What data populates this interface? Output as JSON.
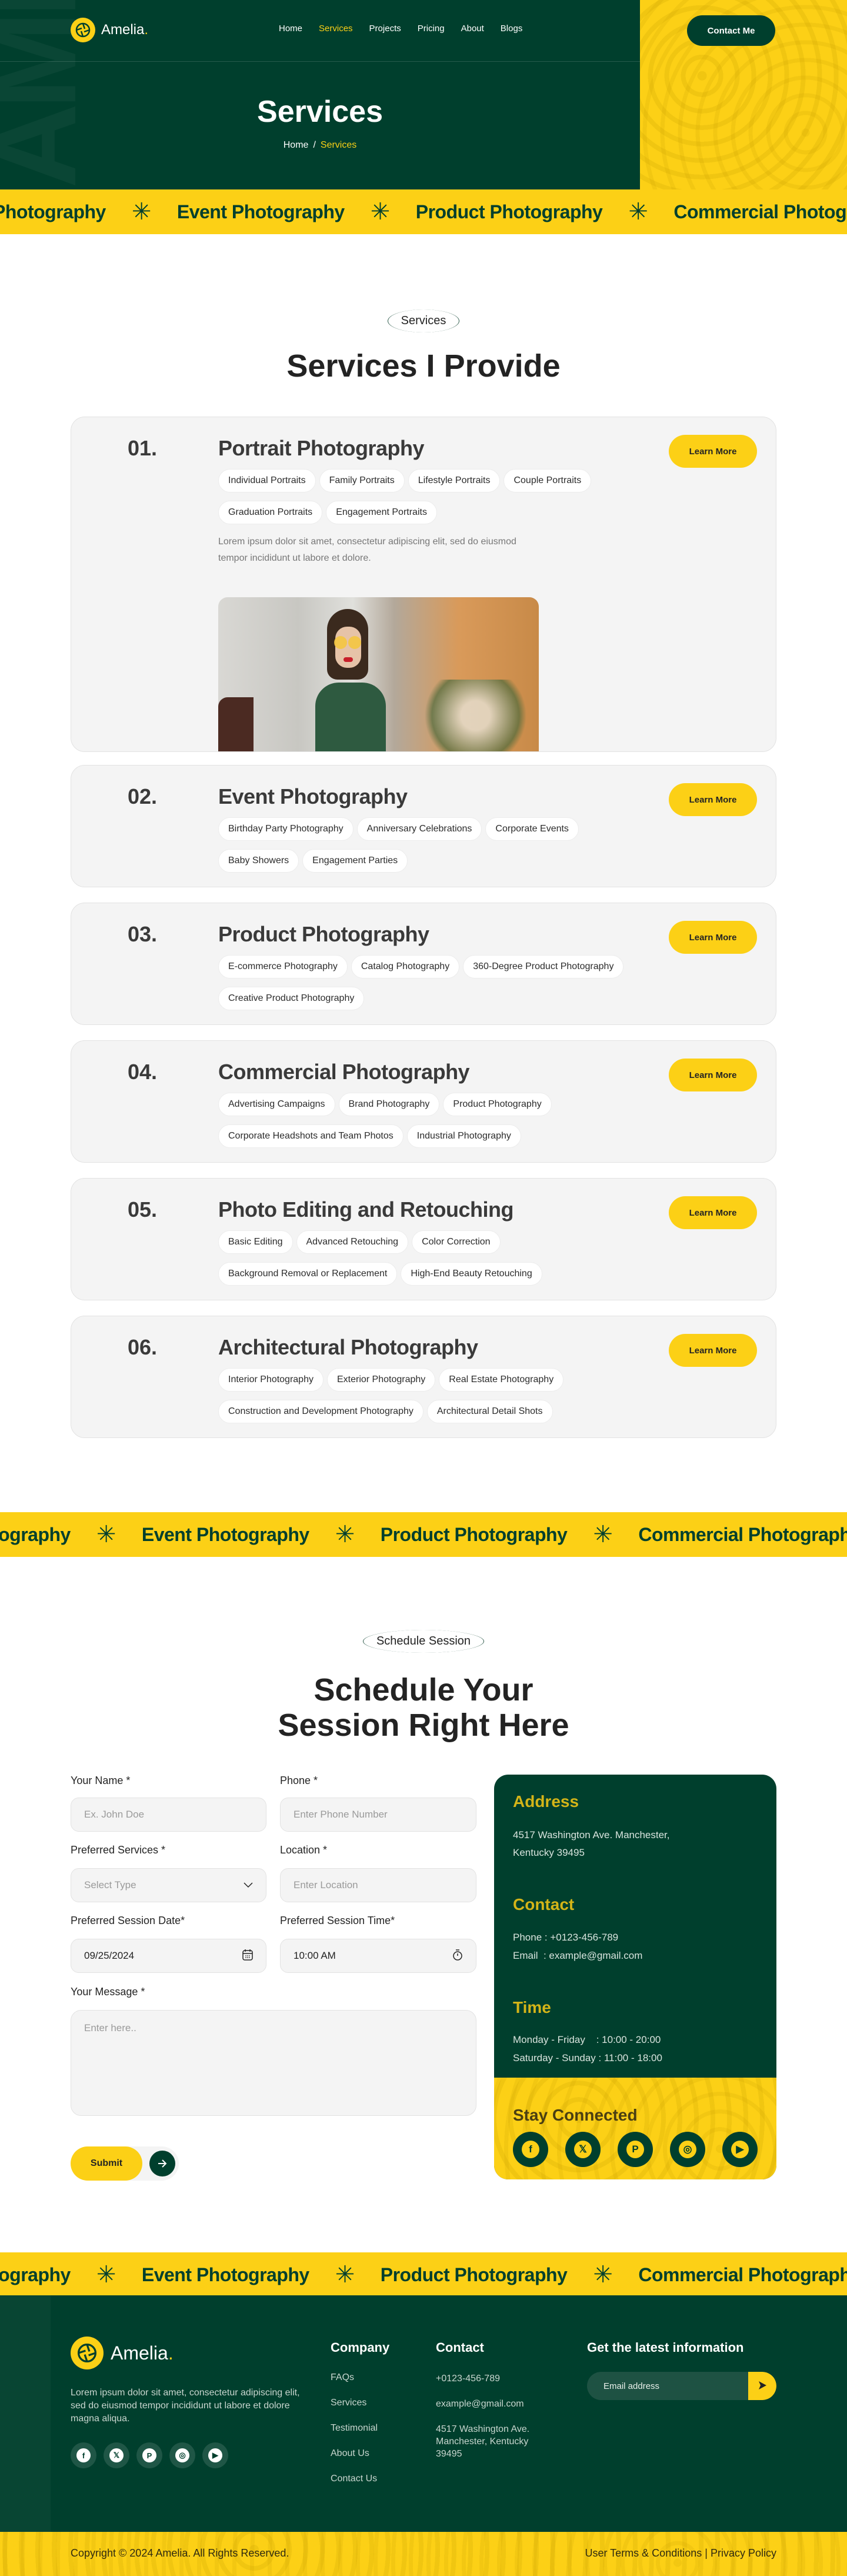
{
  "brand": {
    "name": "Amelia",
    "dot": "."
  },
  "nav": {
    "items": [
      {
        "label": "Home",
        "active": false
      },
      {
        "label": "Services",
        "active": true
      },
      {
        "label": "Projects",
        "active": false
      },
      {
        "label": "Pricing",
        "active": false
      },
      {
        "label": "About",
        "active": false
      },
      {
        "label": "Blogs",
        "active": false
      }
    ],
    "contact_button": "Contact Me"
  },
  "hero": {
    "title": "Services",
    "breadcrumb": {
      "home": "Home",
      "separator": "/",
      "current": "Services"
    }
  },
  "marquee": {
    "items": [
      "Photography",
      "Event Photography",
      "Product Photography",
      "Commercial Photography"
    ],
    "separator_icon": "asterisk-star-icon"
  },
  "services_section": {
    "tag": "Services",
    "title": "Services I Provide",
    "learn_more_label": "Learn More",
    "cards": [
      {
        "num": "01.",
        "title": "Portrait Photography",
        "tags": [
          "Individual Portraits",
          "Family Portraits",
          "Lifestyle Portraits",
          "Couple Portraits",
          "Graduation Portraits",
          "Engagement Portraits"
        ],
        "description": "Lorem ipsum dolor sit amet, consectetur adipiscing elit, sed do eiusmod tempor incididunt ut labore et dolore.",
        "has_image": true
      },
      {
        "num": "02.",
        "title": "Event Photography",
        "tags": [
          "Birthday Party Photography",
          "Anniversary Celebrations",
          "Corporate Events",
          "Baby Showers",
          "Engagement Parties"
        ]
      },
      {
        "num": "03.",
        "title": "Product Photography",
        "tags": [
          "E-commerce Photography",
          "Catalog Photography",
          "360-Degree Product Photography",
          "Creative Product Photography"
        ]
      },
      {
        "num": "04.",
        "title": "Commercial Photography",
        "tags": [
          "Advertising Campaigns",
          "Brand Photography",
          "Product Photography",
          "Corporate Headshots and Team Photos",
          "Industrial Photography"
        ]
      },
      {
        "num": "05.",
        "title": "Photo Editing and Retouching",
        "tags": [
          "Basic Editing",
          "Advanced Retouching",
          "Color Correction",
          "Background Removal or Replacement",
          "High-End Beauty Retouching"
        ]
      },
      {
        "num": "06.",
        "title": "Architectural Photography",
        "tags": [
          "Interior Photography",
          "Exterior Photography",
          "Real Estate Photography",
          "Construction and Development Photography",
          "Architectural Detail Shots"
        ]
      }
    ]
  },
  "schedule": {
    "tag": "Schedule Session",
    "title_line1": "Schedule Your",
    "title_line2": "Session Right Here",
    "form": {
      "name": {
        "label": "Your Name *",
        "placeholder": "Ex. John Doe"
      },
      "phone": {
        "label": "Phone *",
        "placeholder": "Enter Phone Number"
      },
      "services": {
        "label": "Preferred Services *",
        "placeholder": "Select Type"
      },
      "location": {
        "label": "Location *",
        "placeholder": "Enter Location"
      },
      "date": {
        "label": "Preferred Session Date*",
        "value": "09/25/2024"
      },
      "time": {
        "label": "Preferred Session Time*",
        "value": "10:00 AM"
      },
      "message": {
        "label": "Your Message *",
        "placeholder": "Enter here.."
      },
      "submit": "Submit"
    },
    "info": {
      "address_h": "Address",
      "address": "4517 Washington Ave. Manchester,\nKentucky 39495",
      "contact_h": "Contact",
      "phone": "Phone : +0123-456-789",
      "email": "Email  : example@gmail.com",
      "time_h": "Time",
      "weekday": "Monday - Friday    : 10:00 - 20:00",
      "weekend": "Saturday - Sunday : 11:00 - 18:00",
      "stay_h": "Stay Connected",
      "socials": [
        "facebook",
        "x-twitter",
        "pinterest",
        "instagram",
        "youtube"
      ]
    }
  },
  "footer": {
    "description": "Lorem ipsum dolor sit amet, consectetur adipiscing elit, sed do eiusmod tempor incididunt ut labore et dolore magna aliqua.",
    "company_h": "Company",
    "company_links": [
      "FAQs",
      "Services",
      "Testimonial",
      "About Us",
      "Contact Us"
    ],
    "contact_h": "Contact",
    "phone": "+0123-456-789",
    "email": "example@gmail.com",
    "address": "4517 Washington Ave. Manchester, Kentucky 39495",
    "newsletter_h": "Get the latest information",
    "email_placeholder": "Email address",
    "copyright": "Copyright © 2024 Amelia. All Rights Reserved.",
    "terms": "User Terms & Conditions",
    "legal_sep": "|",
    "privacy": "Privacy Policy"
  },
  "colors": {
    "green": "#003f2d",
    "yellow": "#fcd016",
    "card_gray": "#f4f4f4"
  }
}
